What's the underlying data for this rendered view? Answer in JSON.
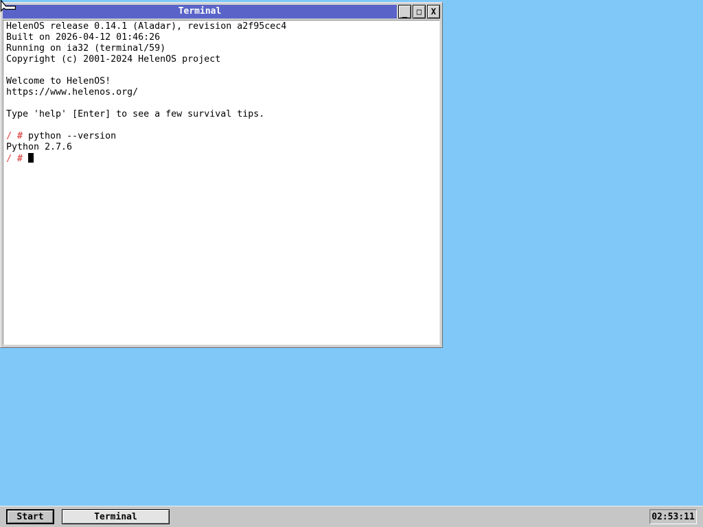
{
  "colors": {
    "desktop": "#7FC8F8",
    "titlebar": "#5A64C8",
    "prompt": "#E05A5A"
  },
  "window": {
    "title": "Terminal",
    "buttons": {
      "minimize_glyph": "_",
      "maximize_glyph": "□",
      "close_glyph": "X"
    }
  },
  "terminal": {
    "lines": [
      {
        "segments": [
          {
            "color": "fg",
            "text": "HelenOS release 0.14.1 (Aladar), revision a2f95cec4"
          }
        ]
      },
      {
        "segments": [
          {
            "color": "fg",
            "text": "Built on 2026-04-12 01:46:26"
          }
        ]
      },
      {
        "segments": [
          {
            "color": "fg",
            "text": "Running on ia32 (terminal/59)"
          }
        ]
      },
      {
        "segments": [
          {
            "color": "fg",
            "text": "Copyright (c) 2001-2024 HelenOS project"
          }
        ]
      },
      {
        "segments": []
      },
      {
        "segments": [
          {
            "color": "fg",
            "text": "Welcome to HelenOS!"
          }
        ]
      },
      {
        "segments": [
          {
            "color": "fg",
            "text": "https://www.helenos.org/"
          }
        ]
      },
      {
        "segments": []
      },
      {
        "segments": [
          {
            "color": "fg",
            "text": "Type 'help' [Enter] to see a few survival tips."
          }
        ]
      },
      {
        "segments": []
      },
      {
        "segments": [
          {
            "color": "prompt",
            "text": "/ #"
          },
          {
            "color": "fg",
            "text": " python --version"
          }
        ]
      },
      {
        "segments": [
          {
            "color": "fg",
            "text": "Python 2.7.6"
          }
        ]
      },
      {
        "segments": [
          {
            "color": "prompt",
            "text": "/ #"
          },
          {
            "color": "fg",
            "text": " "
          }
        ],
        "cursor": true
      }
    ]
  },
  "taskbar": {
    "start_label": "Start",
    "tasks": [
      {
        "label": "Terminal"
      }
    ],
    "clock": "02:53:11"
  }
}
